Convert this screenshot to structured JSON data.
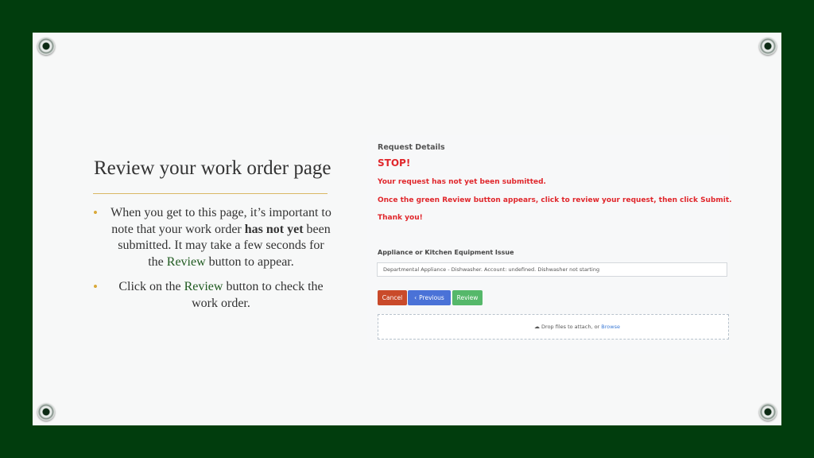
{
  "slide": {
    "title": "Review your work order page",
    "bullets": [
      {
        "pre": "When you get to this page, it’s important to note that your work order ",
        "bold": "has not yet",
        "mid": " been submitted. It may take a few seconds for the ",
        "highlight": "Review",
        "post": " button to appear."
      },
      {
        "pre": "Click on the ",
        "highlight": "Review",
        "post": " button to check the work order."
      }
    ]
  },
  "panel": {
    "header": "Request Details",
    "stop": "STOP!",
    "message1": "Your request has not yet been submitted.",
    "message2": "Once the green Review button appears, click to review your request, then click Submit.",
    "message3": "Thank you!",
    "issue_label": "Appliance or Kitchen Equipment Issue",
    "issue_value": "Departmental Appliance - Dishwasher. Account: undefined. Dishwasher not starting",
    "buttons": {
      "cancel": "Cancel",
      "previous": "Previous",
      "review": "Review"
    },
    "dropzone": {
      "text": "Drop files to attach, or ",
      "link": "Browse"
    }
  },
  "colors": {
    "background": "#013d0d",
    "alert": "#e0262b",
    "cancel": "#c94a2a",
    "previous": "#4a72d7",
    "review": "#55b86a",
    "accent_rule": "#d9b764"
  }
}
